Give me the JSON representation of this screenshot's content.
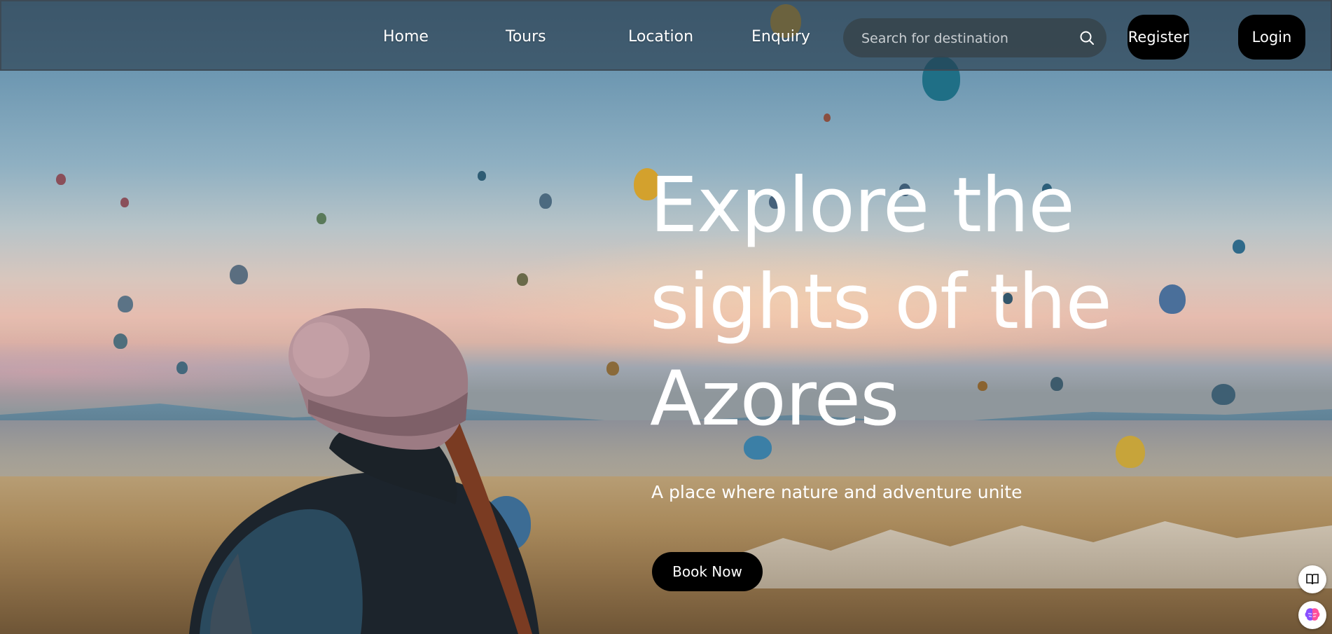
{
  "nav": {
    "links": [
      {
        "label": "Home"
      },
      {
        "label": "Tours"
      },
      {
        "label": "Location"
      },
      {
        "label": "Enquiry"
      }
    ],
    "search_placeholder": "Search for destination",
    "register_label": "Register",
    "login_label": "Login"
  },
  "hero": {
    "title_lines": [
      "Explore the",
      "sights of the",
      "Azores"
    ],
    "subtitle": "A place where nature and adventure unite",
    "cta_label": "Book Now"
  },
  "floating_tools": {
    "icons": [
      "book-icon",
      "brain-icon"
    ]
  },
  "colors": {
    "button_bg": "#000000",
    "nav_bg": "#263a4a",
    "text": "#ffffff"
  }
}
